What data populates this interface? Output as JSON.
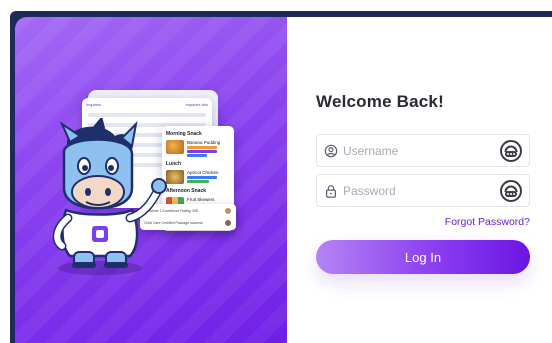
{
  "hero": {
    "mock": {
      "header_left": "Inquiries",
      "header_right": "Inquiries this",
      "menu_sections": [
        "Morning Snack",
        "Lunch",
        "Afternoon Snack"
      ],
      "menu_items": [
        "Banana Pudding",
        "Apricot Chicken",
        "Fruit Skewers"
      ],
      "notifications": [
        "Sunshine 1 Excellence Rating: 5/5!",
        "Child Care Certified Package success"
      ]
    }
  },
  "login": {
    "title": "Welcome Back!",
    "username_placeholder": "Username",
    "password_placeholder": "Password",
    "forgot_label": "Forgot Password?",
    "login_label": "Log In"
  },
  "colors": {
    "accent": "#6c15e4",
    "hero_start": "#a46bf5",
    "hero_end": "#6f1fe6",
    "frame": "#1e2a5a"
  },
  "icons": {
    "username": "user-circle-icon",
    "password": "lock-icon",
    "trailing": "password-manager-icon"
  }
}
